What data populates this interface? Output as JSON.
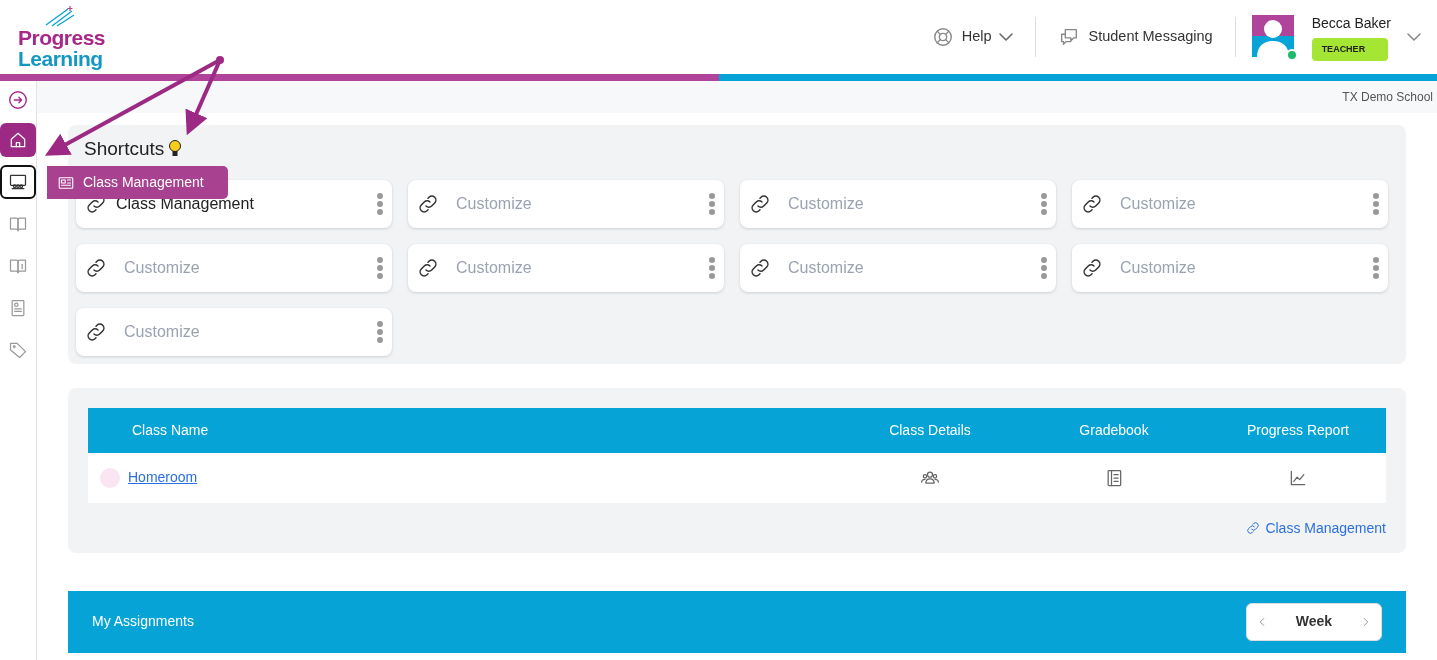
{
  "header": {
    "logo": {
      "line1": "Progress",
      "line2": "Learning"
    },
    "help": "Help",
    "messaging": "Student Messaging",
    "user": {
      "name": "Becca Baker",
      "role": "TEACHER",
      "online": true
    }
  },
  "school": "TX Demo School",
  "sidebar": {
    "items": [
      {
        "kind": "home",
        "selected": true,
        "focused": false
      },
      {
        "kind": "classroom",
        "selected": false,
        "focused": true
      },
      {
        "kind": "book",
        "selected": false,
        "focused": false
      },
      {
        "kind": "guide",
        "selected": false,
        "focused": false
      },
      {
        "kind": "report",
        "selected": false,
        "focused": false
      },
      {
        "kind": "tag",
        "selected": false,
        "focused": false
      }
    ],
    "tooltip": "Class Management"
  },
  "shortcuts": {
    "title": "Shortcuts",
    "items": [
      {
        "label": "Class Management",
        "assigned": true
      },
      {
        "label": "Customize",
        "assigned": false
      },
      {
        "label": "Customize",
        "assigned": false
      },
      {
        "label": "Customize",
        "assigned": false
      },
      {
        "label": "Customize",
        "assigned": false
      },
      {
        "label": "Customize",
        "assigned": false
      },
      {
        "label": "Customize",
        "assigned": false
      },
      {
        "label": "Customize",
        "assigned": false
      },
      {
        "label": "Customize",
        "assigned": false
      }
    ]
  },
  "classes": {
    "columns": [
      "Class Name",
      "Class Details",
      "Gradebook",
      "Progress Report"
    ],
    "rows": [
      {
        "name": "Homeroom",
        "color": "#f9e6f2"
      }
    ],
    "link": "Class Management"
  },
  "assignments": {
    "title": "My Assignments",
    "period": "Week"
  }
}
